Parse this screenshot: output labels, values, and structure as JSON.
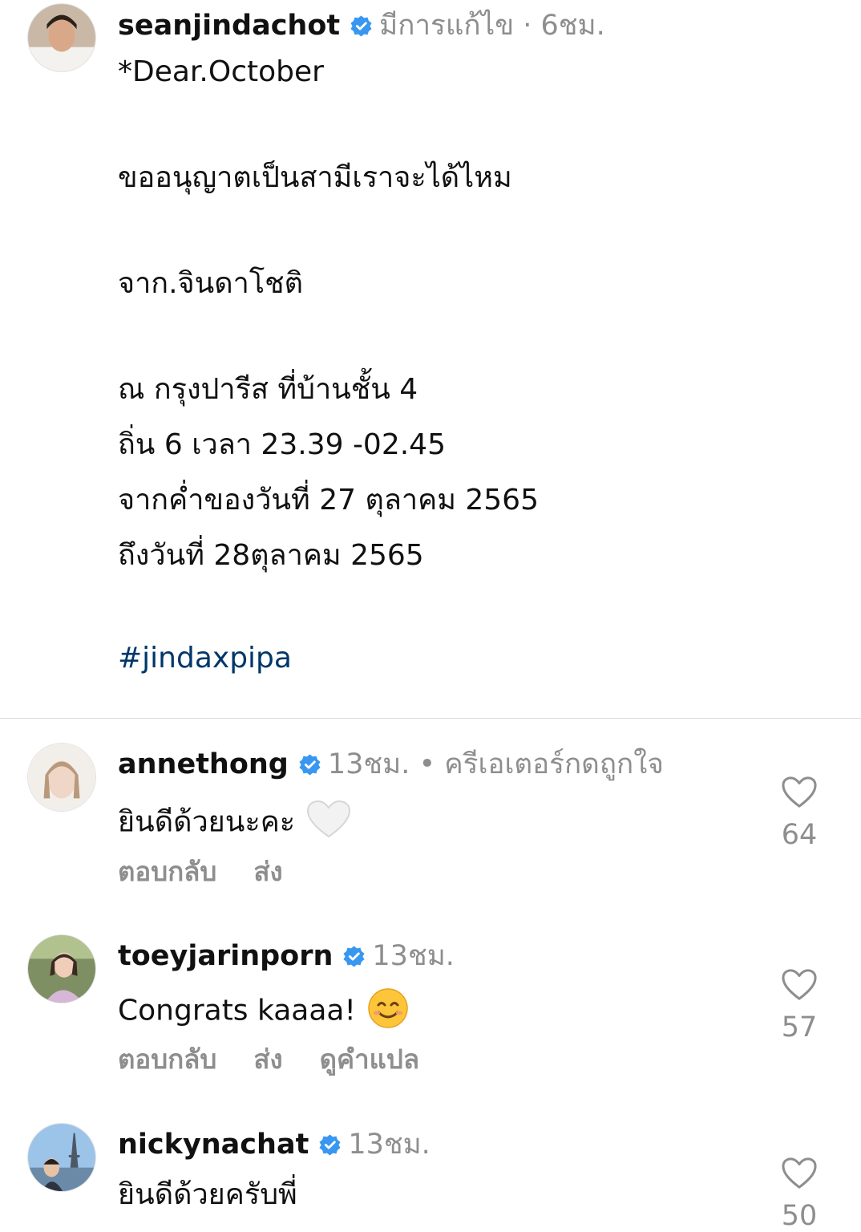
{
  "post": {
    "username": "seanjindachot",
    "meta": "มีการแก้ไข · 6ชม.",
    "lines": [
      "*Dear.October",
      "ขออนุญาตเป็นสามีเราจะได้ไหม",
      "จาก.จินดาโชติ",
      "ณ กรุงปารีส ที่บ้านชั้น 4",
      "ถิ่น 6 เวลา 23.39 -02.45",
      "จากค่ำของวันที่ 27 ตุลาคม 2565",
      "ถึงวันที่ 28ตุลาคม 2565"
    ],
    "hashtag": "#jindaxpipa"
  },
  "comments": [
    {
      "username": "annethong",
      "meta": "13ชม. • ครีเอเตอร์กดถูกใจ",
      "text": "ยินดีด้วยนะคะ",
      "emoji": "white-heart",
      "actions": [
        "ตอบกลับ",
        "ส่ง"
      ],
      "likes": "64"
    },
    {
      "username": "toeyjarinporn",
      "meta": "13ชม.",
      "text": "Congrats kaaaa!",
      "emoji": "smiling-face",
      "actions": [
        "ตอบกลับ",
        "ส่ง",
        "ดูคำแปล"
      ],
      "likes": "57"
    },
    {
      "username": "nickynachat",
      "meta": "13ชม.",
      "text": "ยินดีด้วยครับพี่",
      "likes": "50"
    }
  ],
  "colors": {
    "verified": "#3897f0",
    "meta": "#8e8e8e",
    "hashtag": "#00376b",
    "divider": "#dbdbdb"
  }
}
